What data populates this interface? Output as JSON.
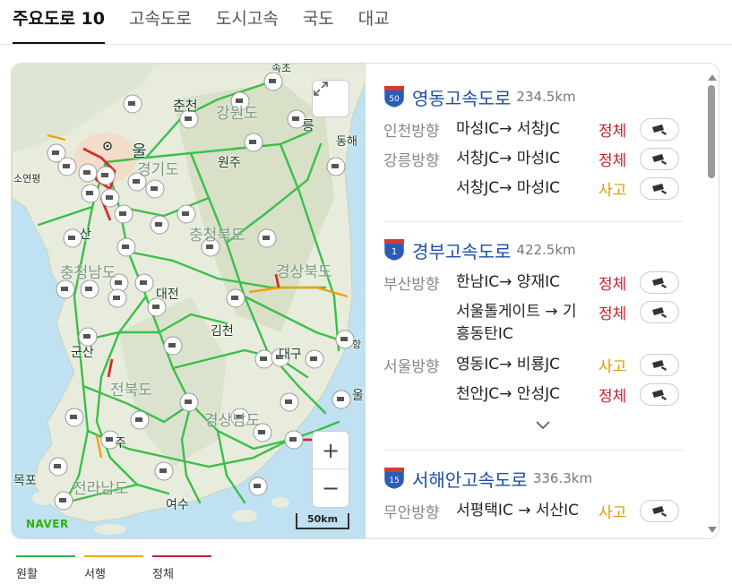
{
  "tabs": [
    {
      "label": "주요도로 10",
      "active": true
    },
    {
      "label": "고속도로"
    },
    {
      "label": "도시고속"
    },
    {
      "label": "국도"
    },
    {
      "label": "대교"
    }
  ],
  "map": {
    "labels": {
      "chuncheon": "춘천",
      "gangwon": "강원도",
      "seoul": "울",
      "gyeonggi": "경기도",
      "wonju": "원주",
      "donghae": "동해",
      "sokcho": "속초",
      "gangneung": "릉",
      "soyeonpyeong": "소연평",
      "chungbuk": "충청북도",
      "san": "산",
      "chungnam": "충청남도",
      "gyeongbuk": "경상북도",
      "daejeon": "대전",
      "gimcheon": "김천",
      "gunsan": "군산",
      "daegu": "대구",
      "jeonbuk": "전북도",
      "ul": "울",
      "hang": "항",
      "gyeongnam": "경상남도",
      "ju": "주",
      "mokpo": "목포",
      "jeonnam": "전라남도",
      "yeosu": "여수"
    },
    "logo": "NAVER",
    "scale": "50km",
    "zoom_in": "+",
    "zoom_out": "−"
  },
  "roads": [
    {
      "number": "50",
      "name": "영동고속도로",
      "distance": "234.5km",
      "rows": [
        {
          "direction": "인천방향",
          "segment": "마성IC→ 서창JC",
          "status": "정체",
          "type": "jam"
        },
        {
          "direction": "강릉방향",
          "segment": "서창JC→ 마성IC",
          "status": "정체",
          "type": "jam"
        },
        {
          "direction": "",
          "segment": "서창JC→ 마성IC",
          "status": "사고",
          "type": "accident"
        }
      ]
    },
    {
      "number": "1",
      "name": "경부고속도로",
      "distance": "422.5km",
      "rows": [
        {
          "direction": "부산방향",
          "segment": "한남IC→ 양재IC",
          "status": "정체",
          "type": "jam"
        },
        {
          "direction": "",
          "segment": "서울톨게이트 → 기흥동탄IC",
          "status": "정체",
          "type": "jam"
        },
        {
          "direction": "서울방향",
          "segment": "영동IC→ 비룡JC",
          "status": "사고",
          "type": "accident"
        },
        {
          "direction": "",
          "segment": "천안JC→ 안성JC",
          "status": "정체",
          "type": "jam"
        }
      ]
    },
    {
      "number": "15",
      "name": "서해안고속도로",
      "distance": "336.3km",
      "rows": [
        {
          "direction": "무안방향",
          "segment": "서평택IC → 서산IC",
          "status": "사고",
          "type": "accident"
        }
      ]
    }
  ],
  "legend": [
    {
      "label": "원활",
      "color": "#2db83d"
    },
    {
      "label": "서행",
      "color": "#f0a30a"
    },
    {
      "label": "정체",
      "color": "#c8202b"
    }
  ],
  "colors": {
    "link_blue": "#1d4fa5",
    "jam": "#c8202b",
    "accident": "#e09a00",
    "shield_blue": "#2b5db6",
    "shield_red": "#d53a2f"
  }
}
